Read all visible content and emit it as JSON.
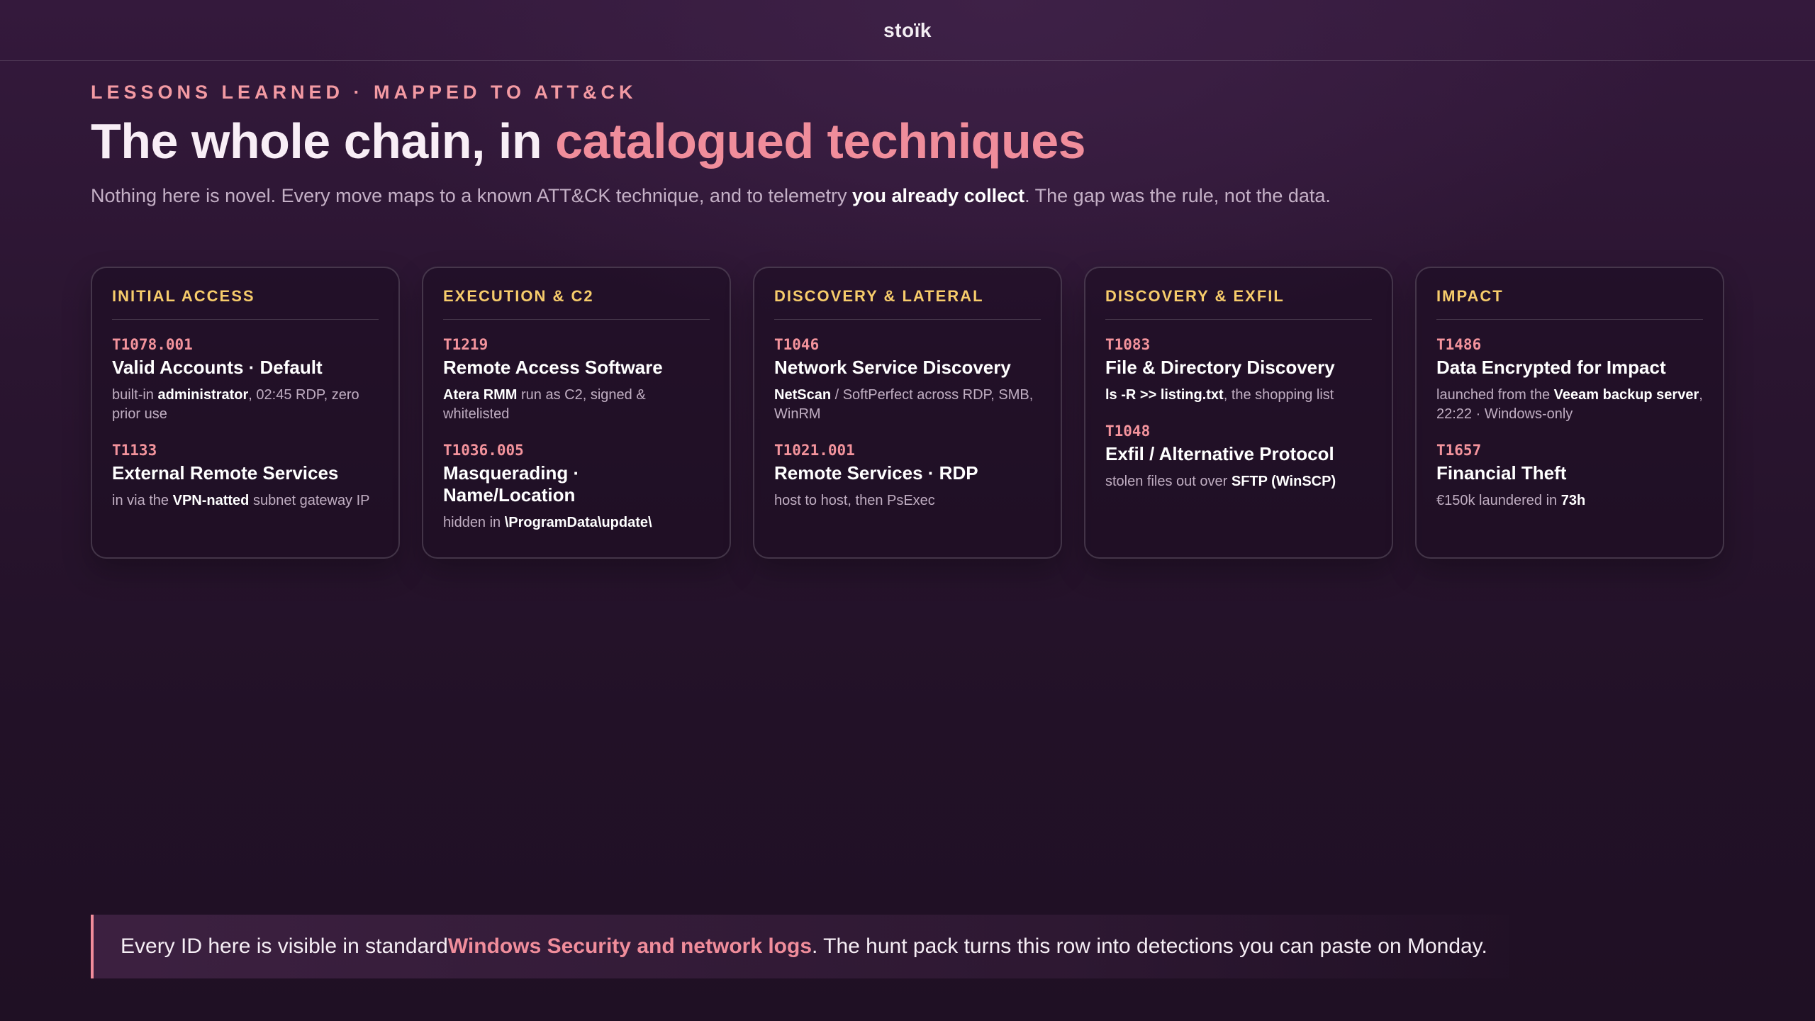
{
  "topbar": {
    "brand": "stoïk"
  },
  "header": {
    "eyebrow": "LESSONS LEARNED · MAPPED TO ATT&CK",
    "title_plain": "The whole chain, in ",
    "title_accent": "catalogued techniques",
    "subtitle_pre": "Nothing here is novel. Every move maps to a known ATT&CK technique, and to telemetry ",
    "subtitle_strong": "you already collect",
    "subtitle_post": ". The gap was the rule, not the data."
  },
  "colors": {
    "accent_pink": "#f08d9b",
    "card_heading_gold": "#f7cc6b",
    "technique_id_pink": "#f3939c",
    "background": "#2a1530"
  },
  "cards": [
    {
      "heading": "INITIAL ACCESS",
      "techniques": [
        {
          "id": "T1078.001",
          "name": "Valid Accounts · Default",
          "desc_pre": "built-in ",
          "desc_b1": "administrator",
          "desc_mid": ", 02:45 RDP, zero prior use",
          "desc_b2": "",
          "desc_post": ""
        },
        {
          "id": "T1133",
          "name": "External Remote Services",
          "desc_pre": "in via the ",
          "desc_b1": "VPN-natted",
          "desc_mid": " subnet gateway IP",
          "desc_b2": "",
          "desc_post": ""
        }
      ]
    },
    {
      "heading": "EXECUTION & C2",
      "techniques": [
        {
          "id": "T1219",
          "name": "Remote Access Software",
          "desc_pre": "",
          "desc_b1": "Atera RMM",
          "desc_mid": " run as C2, signed & whitelisted",
          "desc_b2": "",
          "desc_post": ""
        },
        {
          "id": "T1036.005",
          "name": "Masquerading · Name/Location",
          "desc_pre": "hidden in ",
          "desc_b1": "\\ProgramData\\update\\",
          "desc_mid": "",
          "desc_b2": "",
          "desc_post": ""
        }
      ]
    },
    {
      "heading": "DISCOVERY & LATERAL",
      "techniques": [
        {
          "id": "T1046",
          "name": "Network Service Discovery",
          "desc_pre": "",
          "desc_b1": "NetScan",
          "desc_mid": " / SoftPerfect across RDP, SMB, WinRM",
          "desc_b2": "",
          "desc_post": ""
        },
        {
          "id": "T1021.001",
          "name": "Remote Services · RDP",
          "desc_pre": "host to host, then PsExec",
          "desc_b1": "",
          "desc_mid": "",
          "desc_b2": "",
          "desc_post": ""
        }
      ]
    },
    {
      "heading": "DISCOVERY & EXFIL",
      "techniques": [
        {
          "id": "T1083",
          "name": "File & Directory Discovery",
          "desc_pre": "",
          "desc_b1": "ls -R >> listing.txt",
          "desc_mid": ", the shopping list",
          "desc_b2": "",
          "desc_post": ""
        },
        {
          "id": "T1048",
          "name": "Exfil / Alternative Protocol",
          "desc_pre": "stolen files out over ",
          "desc_b1": "SFTP (WinSCP)",
          "desc_mid": "",
          "desc_b2": "",
          "desc_post": ""
        }
      ]
    },
    {
      "heading": "IMPACT",
      "techniques": [
        {
          "id": "T1486",
          "name": "Data Encrypted for Impact",
          "desc_pre": "launched from the ",
          "desc_b1": "Veeam backup server",
          "desc_mid": ", 22:22 · Windows-only",
          "desc_b2": "",
          "desc_post": ""
        },
        {
          "id": "T1657",
          "name": "Financial Theft",
          "desc_pre": "€150k laundered in ",
          "desc_b1": "73h",
          "desc_mid": "",
          "desc_b2": "",
          "desc_post": ""
        }
      ]
    }
  ],
  "callout": {
    "pre": "Every ID here is visible in standard ",
    "strong": "Windows Security and network logs",
    "post": ". The hunt pack turns this row into detections you can paste on Monday."
  }
}
